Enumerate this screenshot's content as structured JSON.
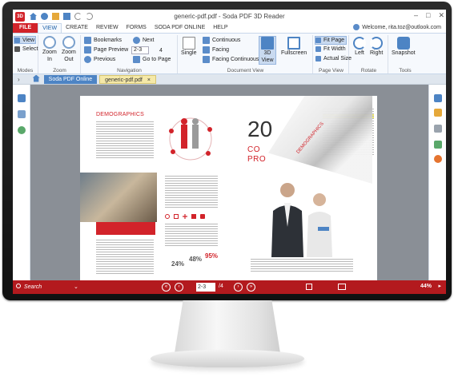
{
  "window": {
    "title": "generic-pdf.pdf - Soda PDF 3D Reader",
    "logo_text": "3D",
    "controls": [
      "–",
      "□",
      "✕"
    ]
  },
  "tabs": [
    "FILE",
    "VIEW",
    "CREATE",
    "REVIEW",
    "FORMS",
    "SODA PDF ONLINE",
    "HELP"
  ],
  "account": {
    "label": "Welcome, rita.toz@outlook.com"
  },
  "ribbon": {
    "modes": {
      "label": "Modes",
      "view": "View",
      "select": "Select"
    },
    "zoom": {
      "label": "Zoom",
      "zoom_in": [
        "Zoom",
        "In"
      ],
      "zoom_out": [
        "Zoom",
        "Out"
      ]
    },
    "navigation": {
      "label": "Navigation",
      "bookmarks": "Bookmarks",
      "page_preview": "Page Preview",
      "previous": "Previous",
      "next": "Next",
      "page_value": "2-3",
      "page_total": "4",
      "goto": "Go to Page"
    },
    "document_view": {
      "label": "Document View",
      "single": "Single",
      "continuous": "Continuous",
      "facing": "Facing",
      "facing_continuous": "Facing Continuous",
      "view_3d": [
        "3D",
        "View"
      ],
      "fullscreen": "Fullscreen"
    },
    "page_view": {
      "label": "Page View",
      "fit_page": "Fit Page",
      "fit_width": "Fit Width",
      "actual_size": "Actual Size"
    },
    "rotate": {
      "label": "Rotate",
      "left": "Left",
      "right": "Right"
    },
    "tools": {
      "label": "Tools",
      "snapshot": "Snapshot"
    }
  },
  "doc_tabs": {
    "home": "Soda PDF Online",
    "document": "generic-pdf.pdf",
    "close": "×"
  },
  "pages": {
    "left_heading": "DEMOGRAPHICS",
    "percentages": [
      "24%",
      "48%",
      "95%"
    ],
    "right_year": "20",
    "right_caps_1": "CO",
    "right_caps_2": "PRO",
    "curl_text": "DEMOGRAPHICS"
  },
  "status": {
    "search": "Search",
    "page_value": "2-3",
    "page_total": "/4",
    "zoom": "44%"
  }
}
